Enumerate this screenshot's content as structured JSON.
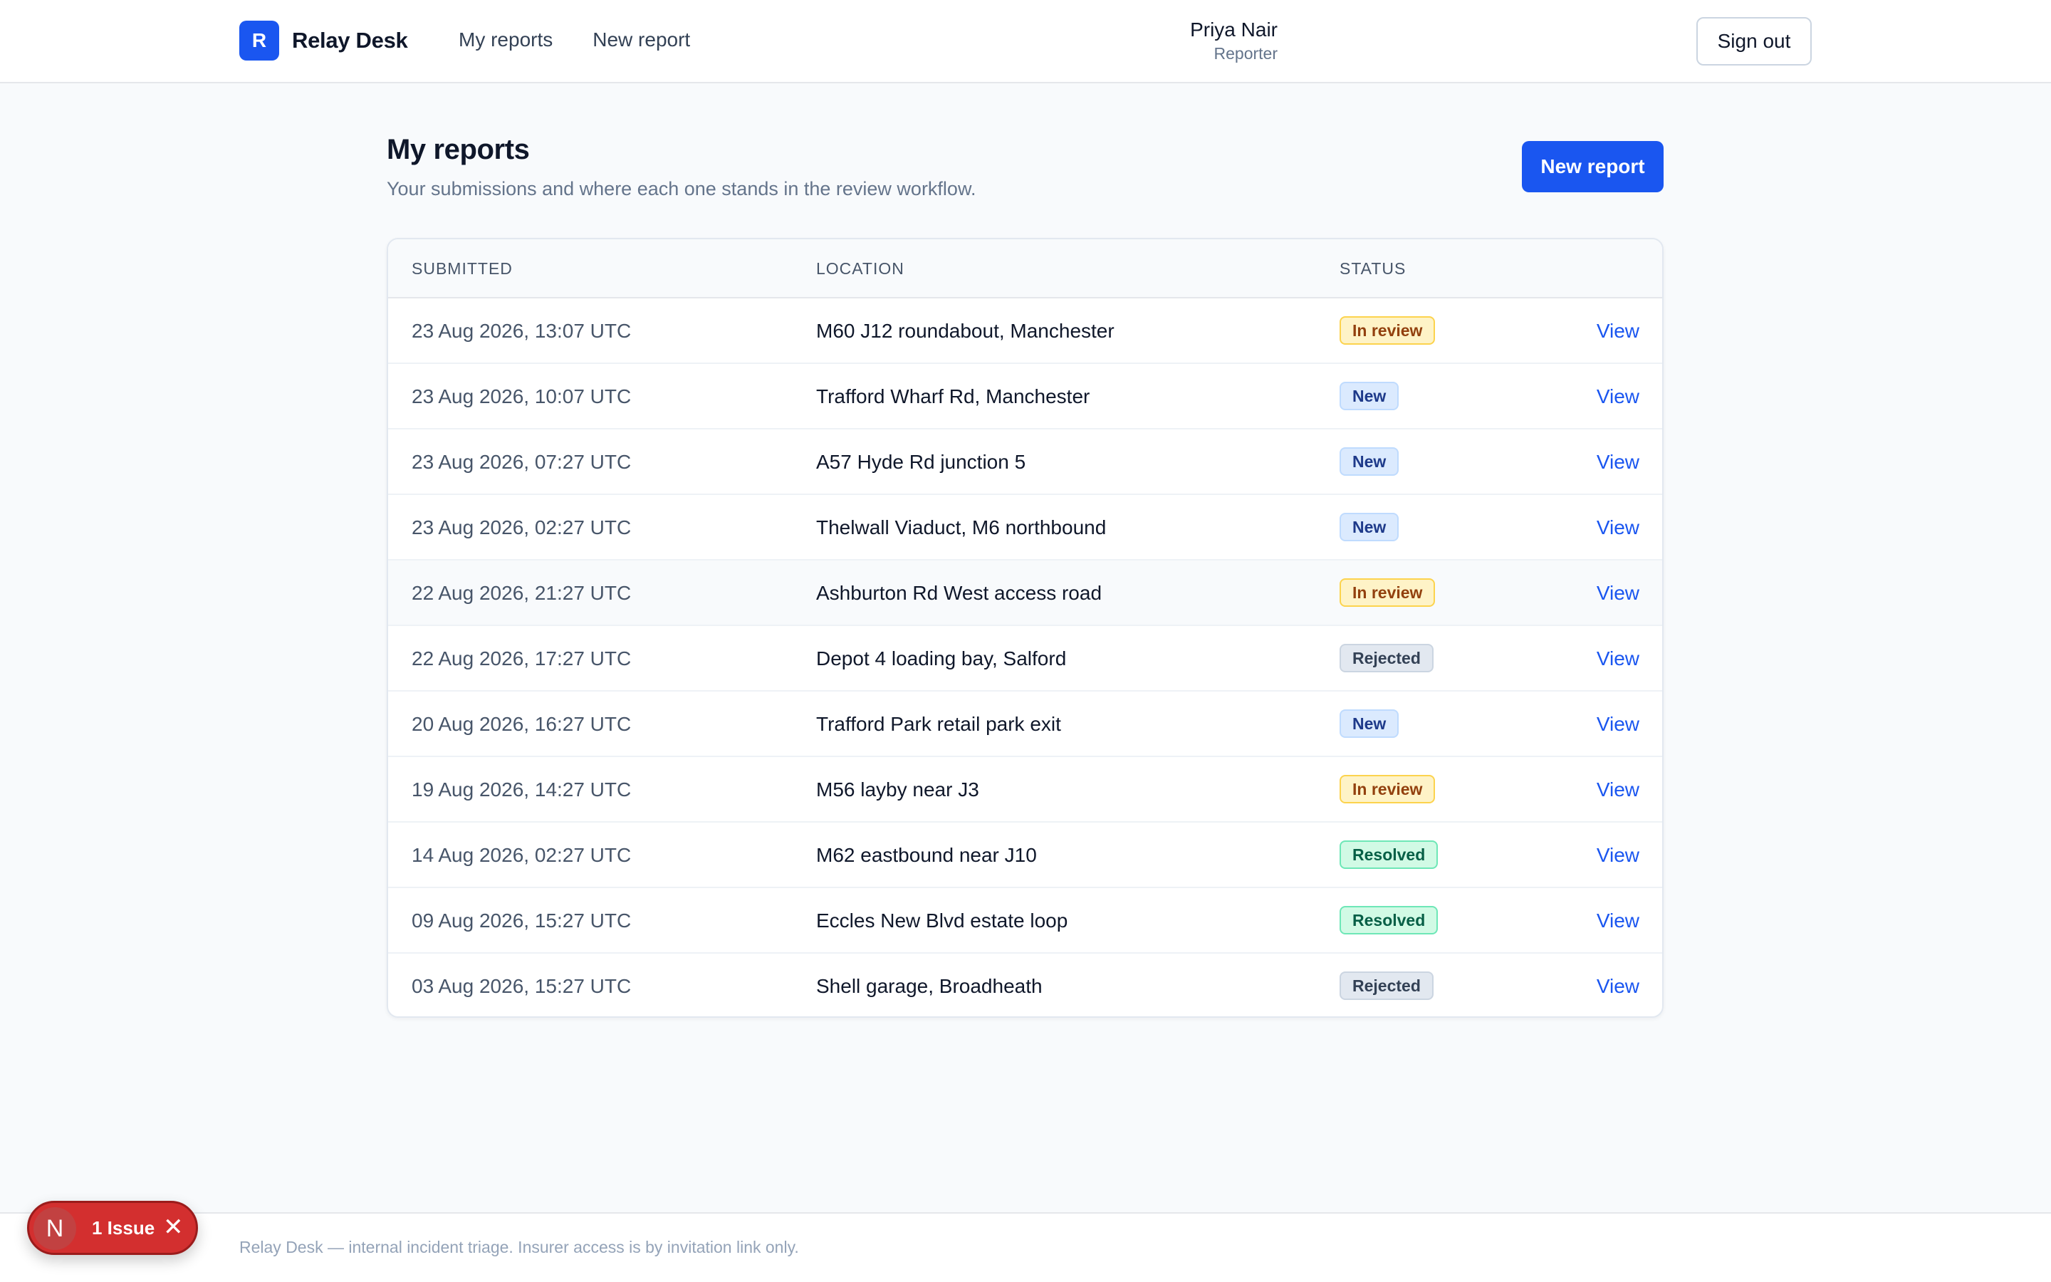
{
  "header": {
    "brand_letter": "R",
    "brand_name": "Relay Desk",
    "nav": [
      "My reports",
      "New report"
    ],
    "user_name": "Priya Nair",
    "user_role": "Reporter",
    "signout_label": "Sign out"
  },
  "page": {
    "title": "My reports",
    "subtitle": "Your submissions and where each one stands in the review workflow.",
    "new_report_label": "New report"
  },
  "table": {
    "columns": [
      "SUBMITTED",
      "LOCATION",
      "STATUS"
    ],
    "view_label": "View",
    "rows": [
      {
        "submitted": "23 Aug 2026, 13:07 UTC",
        "location": "M60 J12 roundabout, Manchester",
        "status": "In review"
      },
      {
        "submitted": "23 Aug 2026, 10:07 UTC",
        "location": "Trafford Wharf Rd, Manchester",
        "status": "New"
      },
      {
        "submitted": "23 Aug 2026, 07:27 UTC",
        "location": "A57 Hyde Rd junction 5",
        "status": "New"
      },
      {
        "submitted": "23 Aug 2026, 02:27 UTC",
        "location": "Thelwall Viaduct, M6 northbound",
        "status": "New"
      },
      {
        "submitted": "22 Aug 2026, 21:27 UTC",
        "location": "Ashburton Rd West access road",
        "status": "In review"
      },
      {
        "submitted": "22 Aug 2026, 17:27 UTC",
        "location": "Depot 4 loading bay, Salford",
        "status": "Rejected"
      },
      {
        "submitted": "20 Aug 2026, 16:27 UTC",
        "location": "Trafford Park retail park exit",
        "status": "New"
      },
      {
        "submitted": "19 Aug 2026, 14:27 UTC",
        "location": "M56 layby near J3",
        "status": "In review"
      },
      {
        "submitted": "14 Aug 2026, 02:27 UTC",
        "location": "M62 eastbound near J10",
        "status": "Resolved"
      },
      {
        "submitted": "09 Aug 2026, 15:27 UTC",
        "location": "Eccles New Blvd estate loop",
        "status": "Resolved"
      },
      {
        "submitted": "03 Aug 2026, 15:27 UTC",
        "location": "Shell garage, Broadheath",
        "status": "Rejected"
      }
    ]
  },
  "footer": {
    "text": "Relay Desk — internal incident triage. Insurer access is by invitation link only."
  },
  "issue_indicator": {
    "logo_letter": "N",
    "label": "1 Issue",
    "close_icon": "close-icon"
  },
  "colors": {
    "accent": "#1a56f0",
    "in_review": "#fef3c7",
    "new": "#dbeafe",
    "rejected": "#e2e8f0",
    "resolved": "#d1fae5",
    "issue": "#d32f2f"
  }
}
